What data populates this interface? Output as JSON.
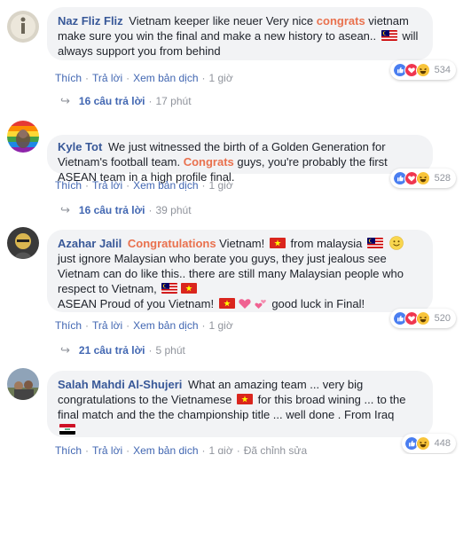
{
  "comments": [
    {
      "author": "Naz Fliz Fliz",
      "text_before": " Vietnam keeper like neuer Very nice ",
      "highlight": "congrats",
      "text_after": " vietnam make sure you win the final and make a new history to asean.. ",
      "text_after_flag": " will always support you from behind",
      "flag_icon": "malaysia-flag",
      "reaction_count": "534",
      "actions": [
        "Thích",
        "Trả lời",
        "Xem bản dịch"
      ],
      "time": "1 giờ",
      "replies_count": "16 câu trả lời",
      "replies_time": "17 phút"
    },
    {
      "author": "Kyle Tot",
      "text_before": " We just witnessed the birth of a Golden Generation for Vietnam's football team. ",
      "highlight": "Congrats",
      "text_after": " guys, you're probably the first ASEAN team in a high profile final.",
      "reaction_count": "528",
      "actions": [
        "Thích",
        "Trả lời",
        "Xem bản dịch"
      ],
      "time": "1 giờ",
      "replies_count": "16 câu trả lời",
      "replies_time": "39 phút"
    },
    {
      "author": "Azahar Jalil",
      "highlight": "Congratulations",
      "part1": " Vietnam! ",
      "part2": " from malaysia ",
      "part3": " just ignore Malaysian who berate you guys, they just jealous see Vietnam can do like this.. there are still many Malaysian people who respect to Vietnam, ",
      "part4": "ASEAN Proud of you Vietnam! ",
      "part5": " good luck in Final!",
      "reaction_count": "520",
      "actions": [
        "Thích",
        "Trả lời",
        "Xem bản dịch"
      ],
      "time": "1 giờ",
      "replies_count": "21 câu trả lời",
      "replies_time": "5 phút"
    },
    {
      "author": "Salah Mahdi Al-Shujeri",
      "part1": " What an amazing team ... very big congratulations to the Vietnamese ",
      "part2": " for this broad wining ... to the final match and the the championship title ... well done . From Iraq",
      "reaction_count": "448",
      "actions": [
        "Thích",
        "Trả lời",
        "Xem bản dịch"
      ],
      "time": "1 giờ",
      "edited": "Đã chỉnh sửa"
    }
  ],
  "colors": {
    "author": "#385898",
    "highlight": "#e9714e",
    "link": "#4267b2",
    "bubble": "#f2f3f5",
    "muted": "#90949c"
  },
  "icons": {
    "reactions": [
      "like-icon",
      "love-icon",
      "haha-icon"
    ],
    "reply_arrow": "reply-arrow-icon"
  }
}
